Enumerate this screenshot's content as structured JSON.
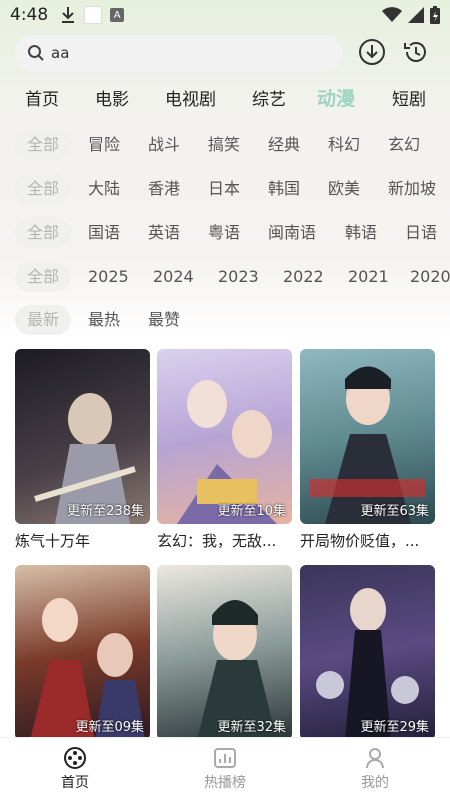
{
  "status_bar": {
    "time": "4:48"
  },
  "search": {
    "value": "aa",
    "placeholder": ""
  },
  "categories": [
    "首页",
    "电影",
    "电视剧",
    "综艺",
    "动漫",
    "短剧"
  ],
  "active_category": "动漫",
  "filters": {
    "genre": [
      "全部",
      "冒险",
      "战斗",
      "搞笑",
      "经典",
      "科幻",
      "玄幻"
    ],
    "region": [
      "全部",
      "大陆",
      "香港",
      "日本",
      "韩国",
      "欧美",
      "新加坡"
    ],
    "language": [
      "全部",
      "国语",
      "英语",
      "粤语",
      "闽南语",
      "韩语",
      "日语"
    ],
    "year": [
      "全部",
      "2025",
      "2024",
      "2023",
      "2022",
      "2021",
      "2020"
    ],
    "sort": [
      "最新",
      "最热",
      "最赞"
    ]
  },
  "items": [
    {
      "title": "炼气十万年",
      "update": "更新至238集",
      "bg1": "#2b2a33",
      "bg2": "#6a5a55"
    },
    {
      "title": "玄幻：我，无敌...",
      "update": "更新至10集",
      "bg1": "#b9a9d9",
      "bg2": "#e7c0c0"
    },
    {
      "title": "开局物价贬值，...",
      "update": "更新至63集",
      "bg1": "#6aa0a8",
      "bg2": "#2f4f58"
    },
    {
      "title": "",
      "update": "更新至09集",
      "bg1": "#7a4a3a",
      "bg2": "#1e1e2a"
    },
    {
      "title": "",
      "update": "更新至32集",
      "bg1": "#c8c4bd",
      "bg2": "#4a5a58"
    },
    {
      "title": "",
      "update": "更新至29集",
      "bg1": "#2e2b4a",
      "bg2": "#6b5a88"
    }
  ],
  "bottom_nav": [
    {
      "label": "首页",
      "icon": "film-reel-icon"
    },
    {
      "label": "热播榜",
      "icon": "chart-icon"
    },
    {
      "label": "我的",
      "icon": "user-icon"
    }
  ],
  "colors": {
    "accent": "#9ed5c0"
  }
}
